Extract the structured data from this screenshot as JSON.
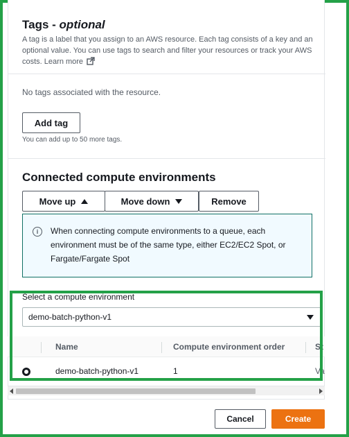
{
  "tags": {
    "title": "Tags -",
    "title_suffix": "optional",
    "description": "A tag is a label that you assign to an AWS resource. Each tag consists of a key and an optional value. You can use tags to search and filter your resources or track your AWS costs.",
    "learn_more": "Learn more",
    "empty_text": "No tags associated with the resource.",
    "add_tag_label": "Add tag",
    "limit_text": "You can add up to 50 more tags."
  },
  "compute": {
    "title": "Connected compute environments",
    "move_up_label": "Move up",
    "move_down_label": "Move down",
    "remove_label": "Remove",
    "info_text": "When connecting compute environments to a queue, each environment must be of the same type, either EC2/EC2 Spot, or Fargate/Fargate Spot",
    "select_label": "Select a compute environment",
    "select_value": "demo-batch-python-v1",
    "table": {
      "columns": [
        "Name",
        "Compute environment order",
        "St"
      ],
      "rows": [
        {
          "name": "demo-batch-python-v1",
          "order": "1",
          "status": "Va"
        }
      ]
    }
  },
  "footer": {
    "cancel_label": "Cancel",
    "create_label": "Create"
  },
  "colors": {
    "highlight": "#24a148",
    "primary_button": "#ec7211",
    "info_border": "#0f6f64"
  }
}
